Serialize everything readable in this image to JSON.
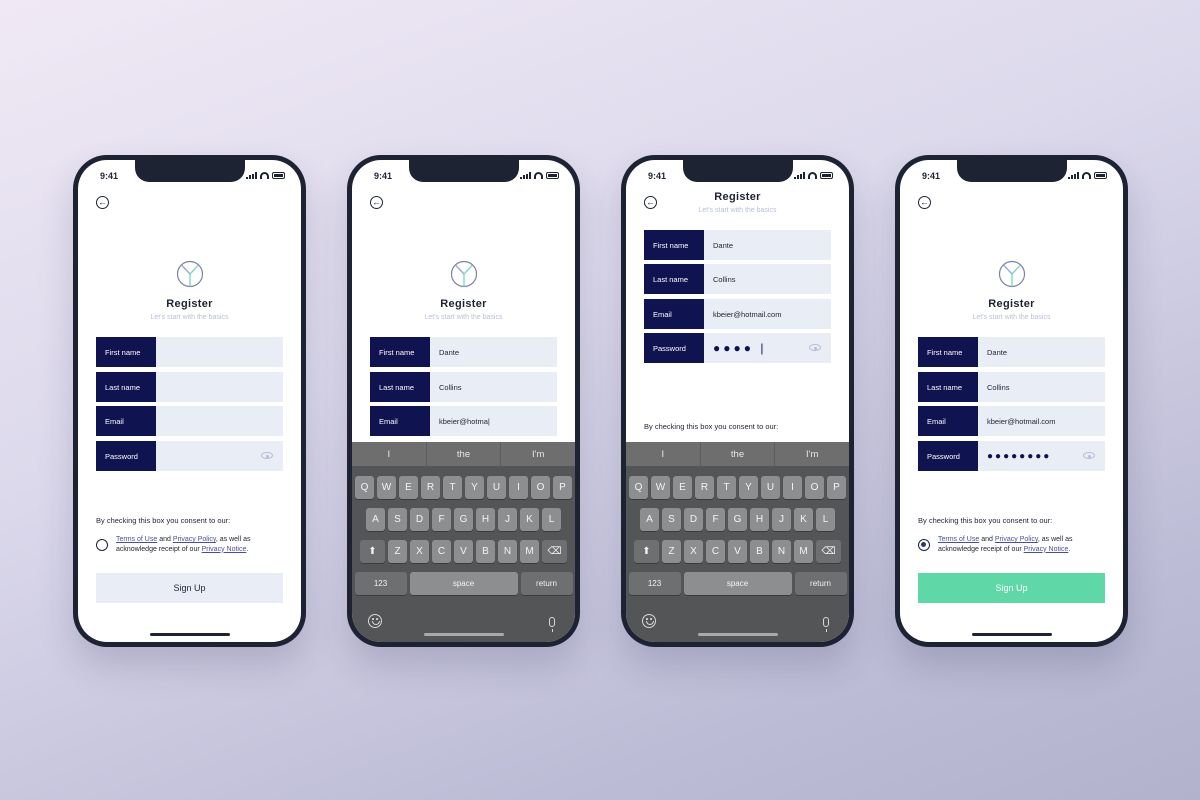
{
  "status_time": "9:41",
  "register": {
    "title": "Register",
    "subtitle": "Let's start with the basics",
    "labels": {
      "first_name": "First name",
      "last_name": "Last name",
      "email": "Email",
      "password": "Password"
    },
    "consent_heading": "By checking this box you consent to our:",
    "terms_link": "Terms of Use",
    "and_text": "and",
    "privacy_policy_link": "Privacy Policy",
    "as_well_as": ", as well as",
    "acknowledge": "acknowledge receipt of our",
    "privacy_notice_link": "Privacy Notice",
    "period": ".",
    "sign_up": "Sign Up"
  },
  "screens": [
    {
      "first_name": "",
      "last_name": "",
      "email": "",
      "password": "",
      "consent_checked": false
    },
    {
      "first_name": "Dante",
      "last_name": "Collins",
      "email": "kbeier@hotma|",
      "password": ""
    },
    {
      "first_name": "Dante",
      "last_name": "Collins",
      "email": "kbeier@hotmail.com",
      "password": "●●●● |"
    },
    {
      "first_name": "Dante",
      "last_name": "Collins",
      "email": "kbeier@hotmail.com",
      "password": "●●●●●●●●",
      "consent_checked": true
    }
  ],
  "keyboard": {
    "suggestions_a": [
      "I",
      "the",
      "I'm"
    ],
    "suggestions_b": [
      "I",
      "the",
      "I'm"
    ],
    "row1": [
      "Q",
      "W",
      "E",
      "R",
      "T",
      "Y",
      "U",
      "I",
      "O",
      "P"
    ],
    "row2": [
      "A",
      "S",
      "D",
      "F",
      "G",
      "H",
      "J",
      "K",
      "L"
    ],
    "row3": [
      "Z",
      "X",
      "C",
      "V",
      "B",
      "N",
      "M"
    ],
    "shift": "⬆",
    "backspace": "⌫",
    "numbers": "123",
    "space": "space",
    "return": "return"
  },
  "colors": {
    "label_bg": "#0f1450",
    "field_bg": "#e9edf6",
    "signup_active": "#5fd7a7"
  }
}
